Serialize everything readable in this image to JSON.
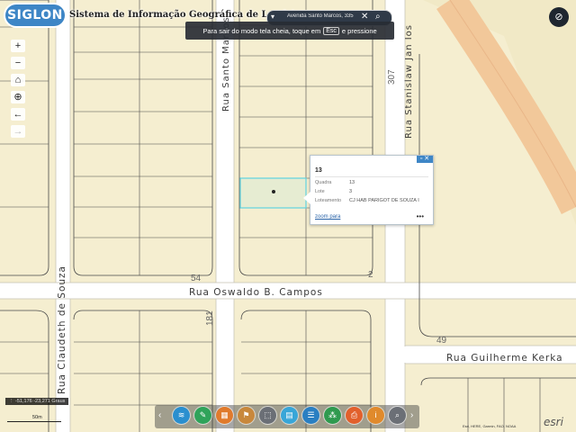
{
  "app": {
    "logo": "SIGLON",
    "title": "Sistema de Informação Geográfica de Londrina"
  },
  "search": {
    "value": "Avenida Santo Marcos, 335"
  },
  "fullscreen_toast": {
    "before": "Para sair do modo tela cheia, toque em",
    "key": "Esc",
    "after": "e pressione"
  },
  "map": {
    "streets": [
      "Rua Santo Marcos",
      "Rua Stanislaw Jan Ios",
      "Rua Oswaldo B. Campos",
      "Rua Claudeth de Souza",
      "Rua Guilherme Kerka"
    ],
    "numbers": [
      "307",
      "54",
      "2",
      "181",
      "49"
    ]
  },
  "popup": {
    "title": "13",
    "fields": [
      {
        "label": "Quadra",
        "value": "13"
      },
      {
        "label": "Lote",
        "value": "3"
      },
      {
        "label": "Loteamento",
        "value": "CJ HAB PARIGOT DE SOUZA I"
      }
    ],
    "zoom_link": "zoom para",
    "more": "•••"
  },
  "coordinates": "-51,176 -23,271 Graus",
  "scale_label": "50m",
  "attribution": "Esri, HERE, Garmin, FAO, NOAA",
  "esri_logo": "esri",
  "colors": {
    "land": "#f5eed0",
    "road": "#ffffff",
    "accent": "#3e86c6",
    "highway": "#f2c89a"
  },
  "toolbar": {
    "buttons": [
      {
        "icon": "layers-icon",
        "color": "#2a8fcf"
      },
      {
        "icon": "pencil-icon",
        "color": "#2fa35a"
      },
      {
        "icon": "grid-icon",
        "color": "#e07a2c"
      },
      {
        "icon": "pin-icon",
        "color": "#c8883c"
      },
      {
        "icon": "print-icon",
        "color": "#6b6f76"
      },
      {
        "icon": "basemap-icon",
        "color": "#38a6d8"
      },
      {
        "icon": "list-icon",
        "color": "#2a7fc2"
      },
      {
        "icon": "network-icon",
        "color": "#2f9a4f"
      },
      {
        "icon": "printer-icon",
        "color": "#e2602c"
      },
      {
        "icon": "info-icon",
        "color": "#e08a2c"
      },
      {
        "icon": "search-person-icon",
        "color": "#6b6f76"
      }
    ]
  }
}
